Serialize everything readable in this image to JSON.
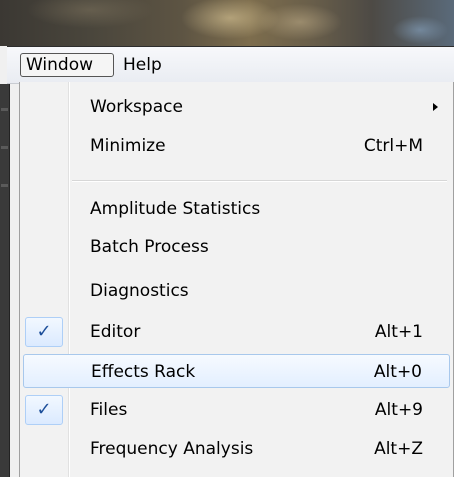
{
  "menubar": {
    "items": [
      {
        "label": "Window",
        "active": true
      },
      {
        "label": "Help",
        "active": false
      }
    ]
  },
  "window_menu": {
    "items": [
      {
        "label": "Workspace",
        "shortcut": "",
        "has_submenu": true,
        "checked": false,
        "highlighted": false
      },
      {
        "label": "Minimize",
        "shortcut": "Ctrl+M",
        "has_submenu": false,
        "checked": false,
        "highlighted": false
      },
      {
        "label": "Amplitude Statistics",
        "shortcut": "",
        "has_submenu": false,
        "checked": false,
        "highlighted": false
      },
      {
        "label": "Batch Process",
        "shortcut": "",
        "has_submenu": false,
        "checked": false,
        "highlighted": false
      },
      {
        "label": "Diagnostics",
        "shortcut": "",
        "has_submenu": false,
        "checked": false,
        "highlighted": false
      },
      {
        "label": "Editor",
        "shortcut": "Alt+1",
        "has_submenu": false,
        "checked": true,
        "highlighted": false
      },
      {
        "label": "Effects Rack",
        "shortcut": "Alt+0",
        "has_submenu": false,
        "checked": false,
        "highlighted": true
      },
      {
        "label": "Files",
        "shortcut": "Alt+9",
        "has_submenu": false,
        "checked": true,
        "highlighted": false
      },
      {
        "label": "Frequency Analysis",
        "shortcut": "Alt+Z",
        "has_submenu": false,
        "checked": false,
        "highlighted": false
      }
    ],
    "check_mark": "✓"
  },
  "colors": {
    "check": "#1d4f9a",
    "highlight_border": "#a8c8ec",
    "menu_bg": "#f2f2f2"
  }
}
